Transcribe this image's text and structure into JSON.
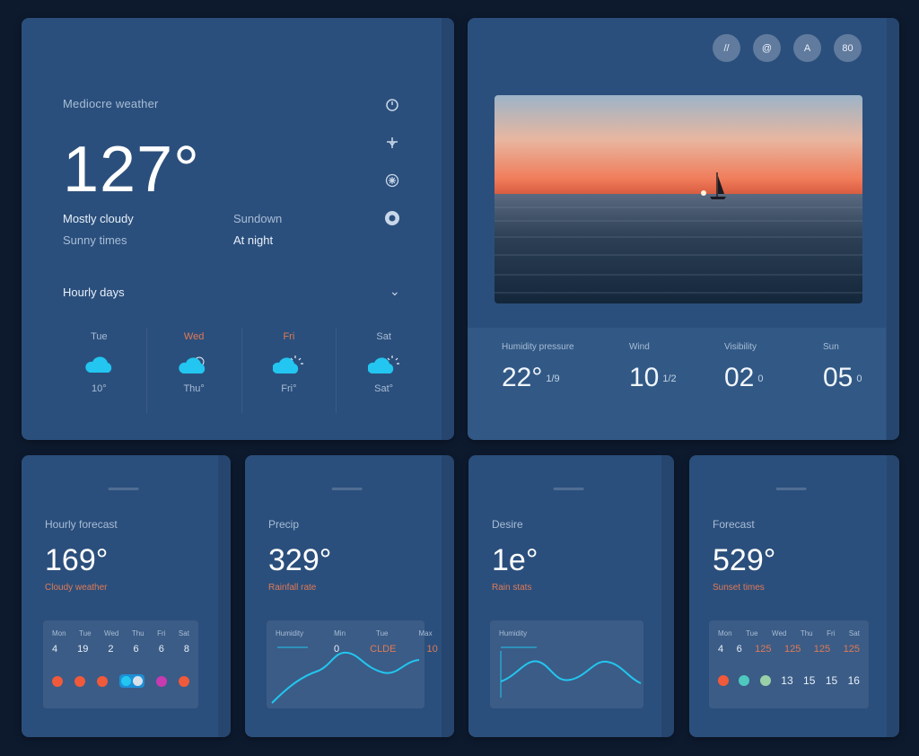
{
  "main": {
    "location": "Mediocre weather",
    "temp": "127°",
    "details_a": [
      "Mostly cloudy",
      "Sunny times"
    ],
    "details_b": [
      "Sundown",
      "At night"
    ],
    "section_label": "Hourly days",
    "forecast": [
      {
        "day": "Tue",
        "temp": "10°"
      },
      {
        "day": "Wed",
        "temp": "Thu°"
      },
      {
        "day": "Fri",
        "temp": "Fri°"
      },
      {
        "day": "Sat",
        "temp": "Sat°"
      }
    ]
  },
  "photo": {
    "buttons": [
      "//",
      "@",
      "A",
      "80"
    ],
    "stats": [
      {
        "label": "Humidity pressure",
        "value": "22°",
        "unit": "1/9"
      },
      {
        "label": "Wind",
        "value": "10",
        "unit": "1/2"
      },
      {
        "label": "Visibility",
        "value": "02",
        "unit": "0"
      },
      {
        "label": "Sun",
        "value": "05",
        "unit": "0"
      }
    ]
  },
  "cards": [
    {
      "label": "Hourly forecast",
      "temp": "169°",
      "sub": "Cloudy weather",
      "headers": [
        "Mon",
        "Tue",
        "Wed",
        "Thu",
        "Fri",
        "Sat"
      ],
      "values": [
        "4",
        "19",
        "2",
        "6",
        "6",
        "8"
      ]
    },
    {
      "label": "Precip",
      "temp": "329°",
      "sub": "Rainfall rate",
      "headers": [
        "Humidity",
        "Min",
        "Tue",
        "Max"
      ],
      "values": [
        "",
        "0",
        "CLDE",
        "10"
      ]
    },
    {
      "label": "Desire",
      "temp": "1e°",
      "sub": "Rain stats",
      "headers": [
        "Humidity"
      ],
      "values": []
    },
    {
      "label": "Forecast",
      "temp": "529°",
      "sub": "Sunset times",
      "headers": [
        "Mon",
        "Tue",
        "Wed",
        "Thu",
        "Fri",
        "Sat"
      ],
      "values": [
        "4",
        "6",
        "125",
        "125",
        "125",
        "125"
      ],
      "bottom": [
        "13",
        "15",
        "15",
        "16"
      ]
    }
  ],
  "colors": {
    "background": "#0d1a2e",
    "card": "#2b4f7c",
    "accent_orange": "#e07a55",
    "cyan": "#22c6f0"
  },
  "icons": [
    "sun-icon",
    "umbrella-icon",
    "snowflake-icon",
    "settings-icon",
    "cloud-icon"
  ]
}
